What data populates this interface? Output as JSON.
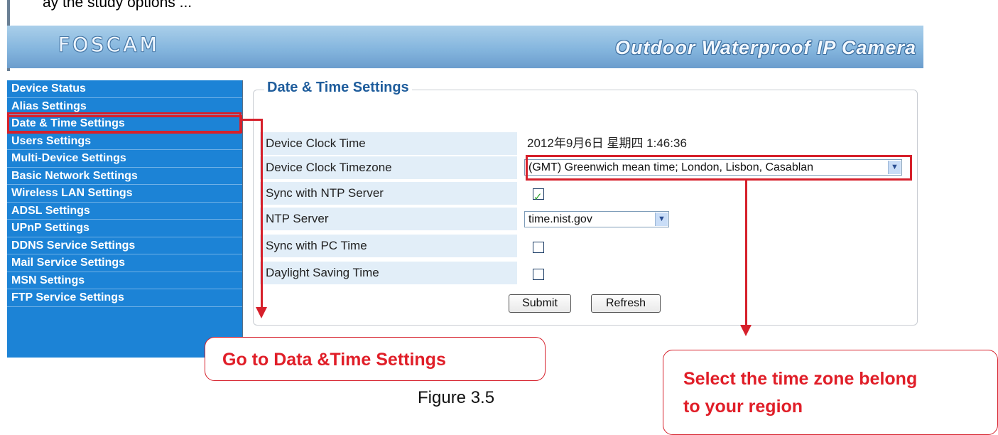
{
  "top_cut_text": "ay the study options ...",
  "header": {
    "logo": "FOSCAM",
    "tagline": "Outdoor Waterproof IP Camera"
  },
  "sidebar": {
    "items": [
      {
        "label": "Device Status"
      },
      {
        "label": "Alias Settings"
      },
      {
        "label": "Date & Time Settings",
        "active": true
      },
      {
        "label": "Users Settings"
      },
      {
        "label": "Multi-Device Settings"
      },
      {
        "label": "Basic Network Settings"
      },
      {
        "label": "Wireless LAN Settings"
      },
      {
        "label": "ADSL Settings"
      },
      {
        "label": "UPnP Settings"
      },
      {
        "label": "DDNS Service Settings"
      },
      {
        "label": "Mail Service Settings"
      },
      {
        "label": "MSN Settings"
      },
      {
        "label": "FTP Service Settings"
      }
    ]
  },
  "panel": {
    "title": "Date & Time Settings",
    "rows": [
      {
        "label": "Device Clock Time",
        "value": "2012年9月6日 星期四 1:46:36"
      },
      {
        "label": "Device Clock Timezone",
        "value": "(GMT) Greenwich mean time; London, Lisbon, Casablan"
      },
      {
        "label": "Sync with NTP Server",
        "checked": true
      },
      {
        "label": "NTP Server",
        "value": "time.nist.gov"
      },
      {
        "label": "Sync with PC Time",
        "checked": false
      },
      {
        "label": "Daylight Saving Time",
        "checked": false
      }
    ],
    "submit_label": "Submit",
    "refresh_label": "Refresh"
  },
  "annotations": {
    "left_callout": "Go to Data &Time Settings",
    "right_callout_line1": "Select the time zone belong",
    "right_callout_line2": "to your region",
    "color": "#d6202b"
  },
  "caption": "Figure 3.5",
  "icons": {
    "dropdown": "chevron-down-icon",
    "checkbox_mark": "check-icon"
  }
}
